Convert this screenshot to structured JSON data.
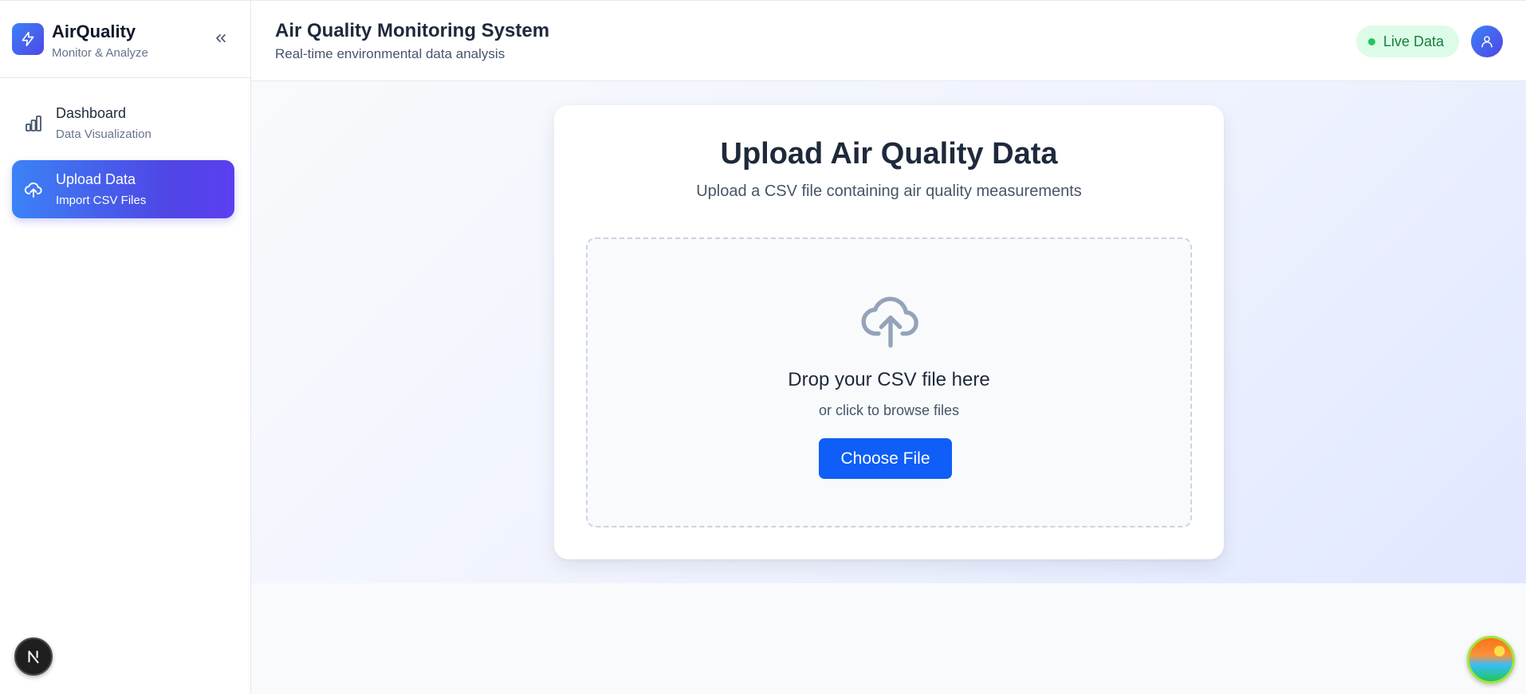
{
  "brand": {
    "title": "AirQuality",
    "subtitle": "Monitor & Analyze"
  },
  "sidebar": {
    "items": [
      {
        "label": "Dashboard",
        "sub": "Data Visualization",
        "icon": "bar-chart-icon",
        "active": false
      },
      {
        "label": "Upload Data",
        "sub": "Import CSV Files",
        "icon": "cloud-upload-icon",
        "active": true
      }
    ],
    "next_badge": "N"
  },
  "header": {
    "title": "Air Quality Monitoring System",
    "subtitle": "Real-time environmental data analysis",
    "live_label": "Live Data"
  },
  "upload": {
    "title": "Upload Air Quality Data",
    "subtitle": "Upload a CSV file containing air quality measurements",
    "drop_title": "Drop your CSV file here",
    "drop_sub": "or click to browse files",
    "button_label": "Choose File"
  },
  "colors": {
    "accent": "#4f46e5",
    "primary_button": "#0f5ef7",
    "live_bg": "#dcfce7",
    "live_text": "#15803d"
  }
}
